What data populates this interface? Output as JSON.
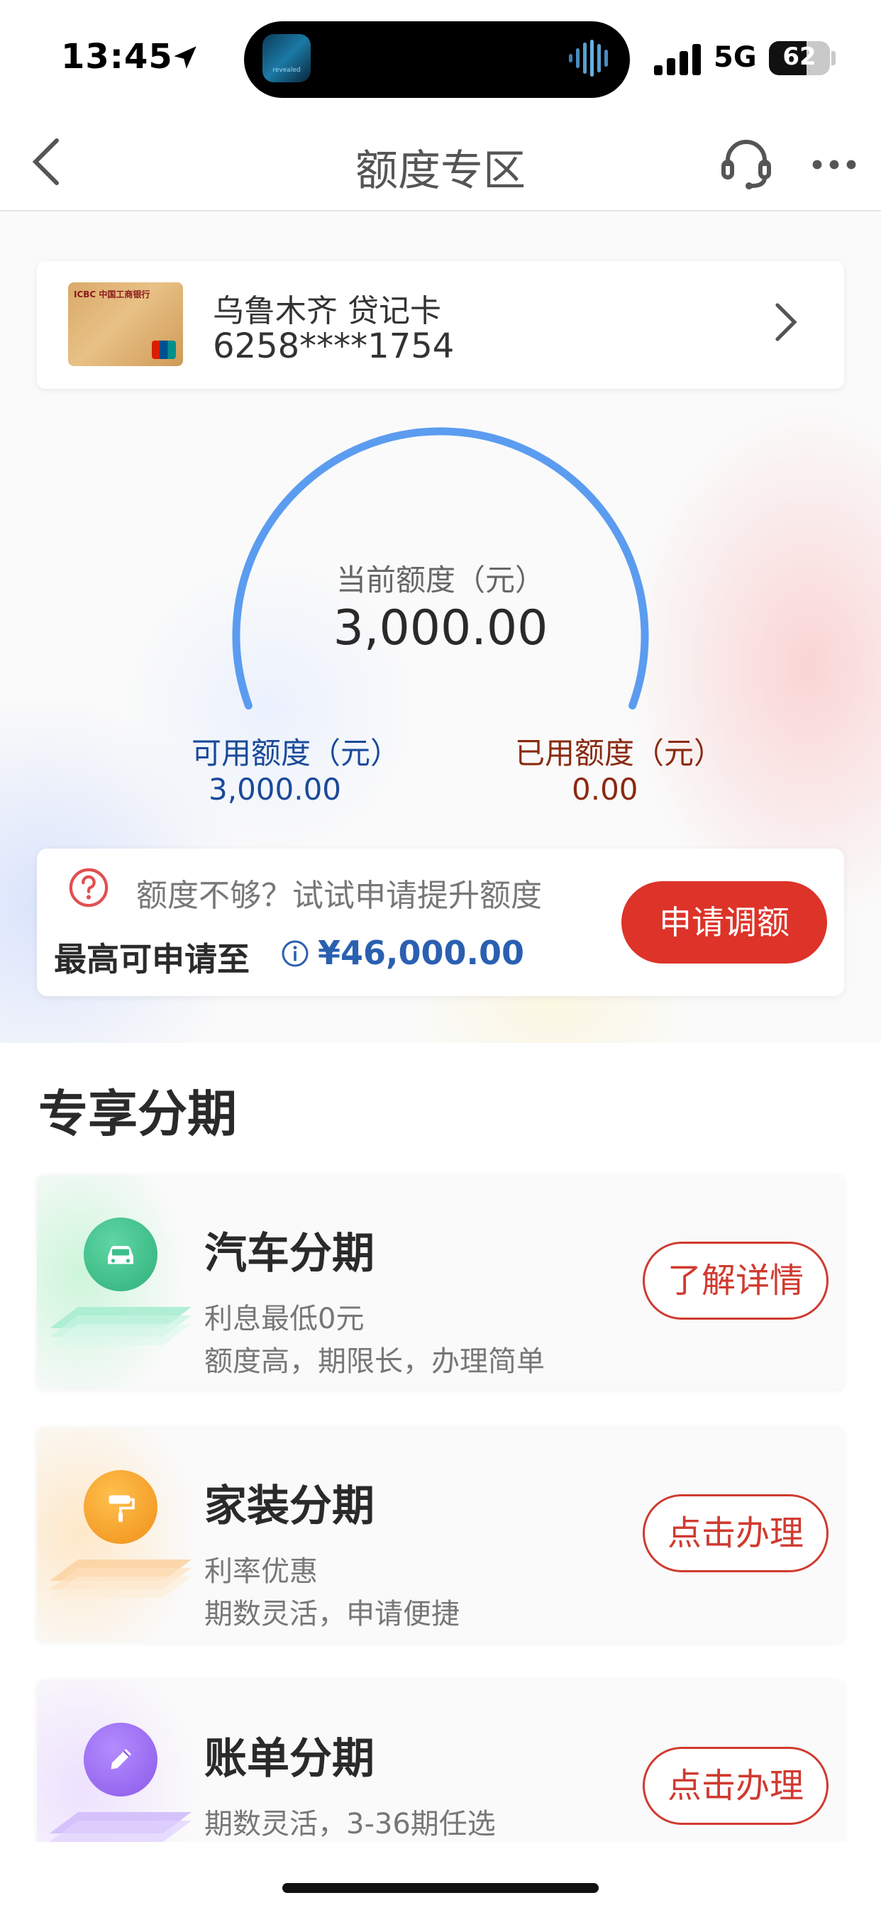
{
  "status_bar": {
    "time": "13:45",
    "island_app_label": "revealed",
    "network": "5G",
    "battery": "62",
    "battery_level": 0.62
  },
  "nav": {
    "title": "额度专区",
    "icons": [
      "back-icon",
      "customer-service-icon",
      "more-icon"
    ]
  },
  "card": {
    "name": "乌鲁木齐 贷记卡",
    "number": "6258****1754",
    "image_text": "ICBC 中国工商银行"
  },
  "gauge": {
    "label": "当前额度（元）",
    "value": "3,000.00",
    "available_label": "可用额度（元）",
    "available_value": "3,000.00",
    "used_label": "已用额度（元）",
    "used_value": "0.00",
    "available_fraction": 1.0
  },
  "quota": {
    "hint": "额度不够？试试申请提升额度",
    "max_label": "最高可申请至",
    "max_value": "¥46,000.00",
    "apply_button": "申请调额"
  },
  "section": {
    "title": "专享分期"
  },
  "plans": [
    {
      "title": "汽车分期",
      "desc1": "利息最低0元",
      "desc2": "额度高，期限长，办理简单",
      "button": "了解详情",
      "icon": "car-icon",
      "color": "#3cbf8c"
    },
    {
      "title": "家装分期",
      "desc1": "利率优惠",
      "desc2": "期数灵活，申请便捷",
      "button": "点击办理",
      "icon": "paint-roller-icon",
      "color": "#f4a52b"
    },
    {
      "title": "账单分期",
      "desc1": "期数灵活，3-36期任选",
      "desc2": "",
      "button": "点击办理",
      "icon": "pencil-icon",
      "color": "#9b6cf0"
    }
  ],
  "colors": {
    "accent_red": "#dd3328",
    "gauge_blue": "#5b9cf0",
    "link_blue": "#2a60b0"
  }
}
